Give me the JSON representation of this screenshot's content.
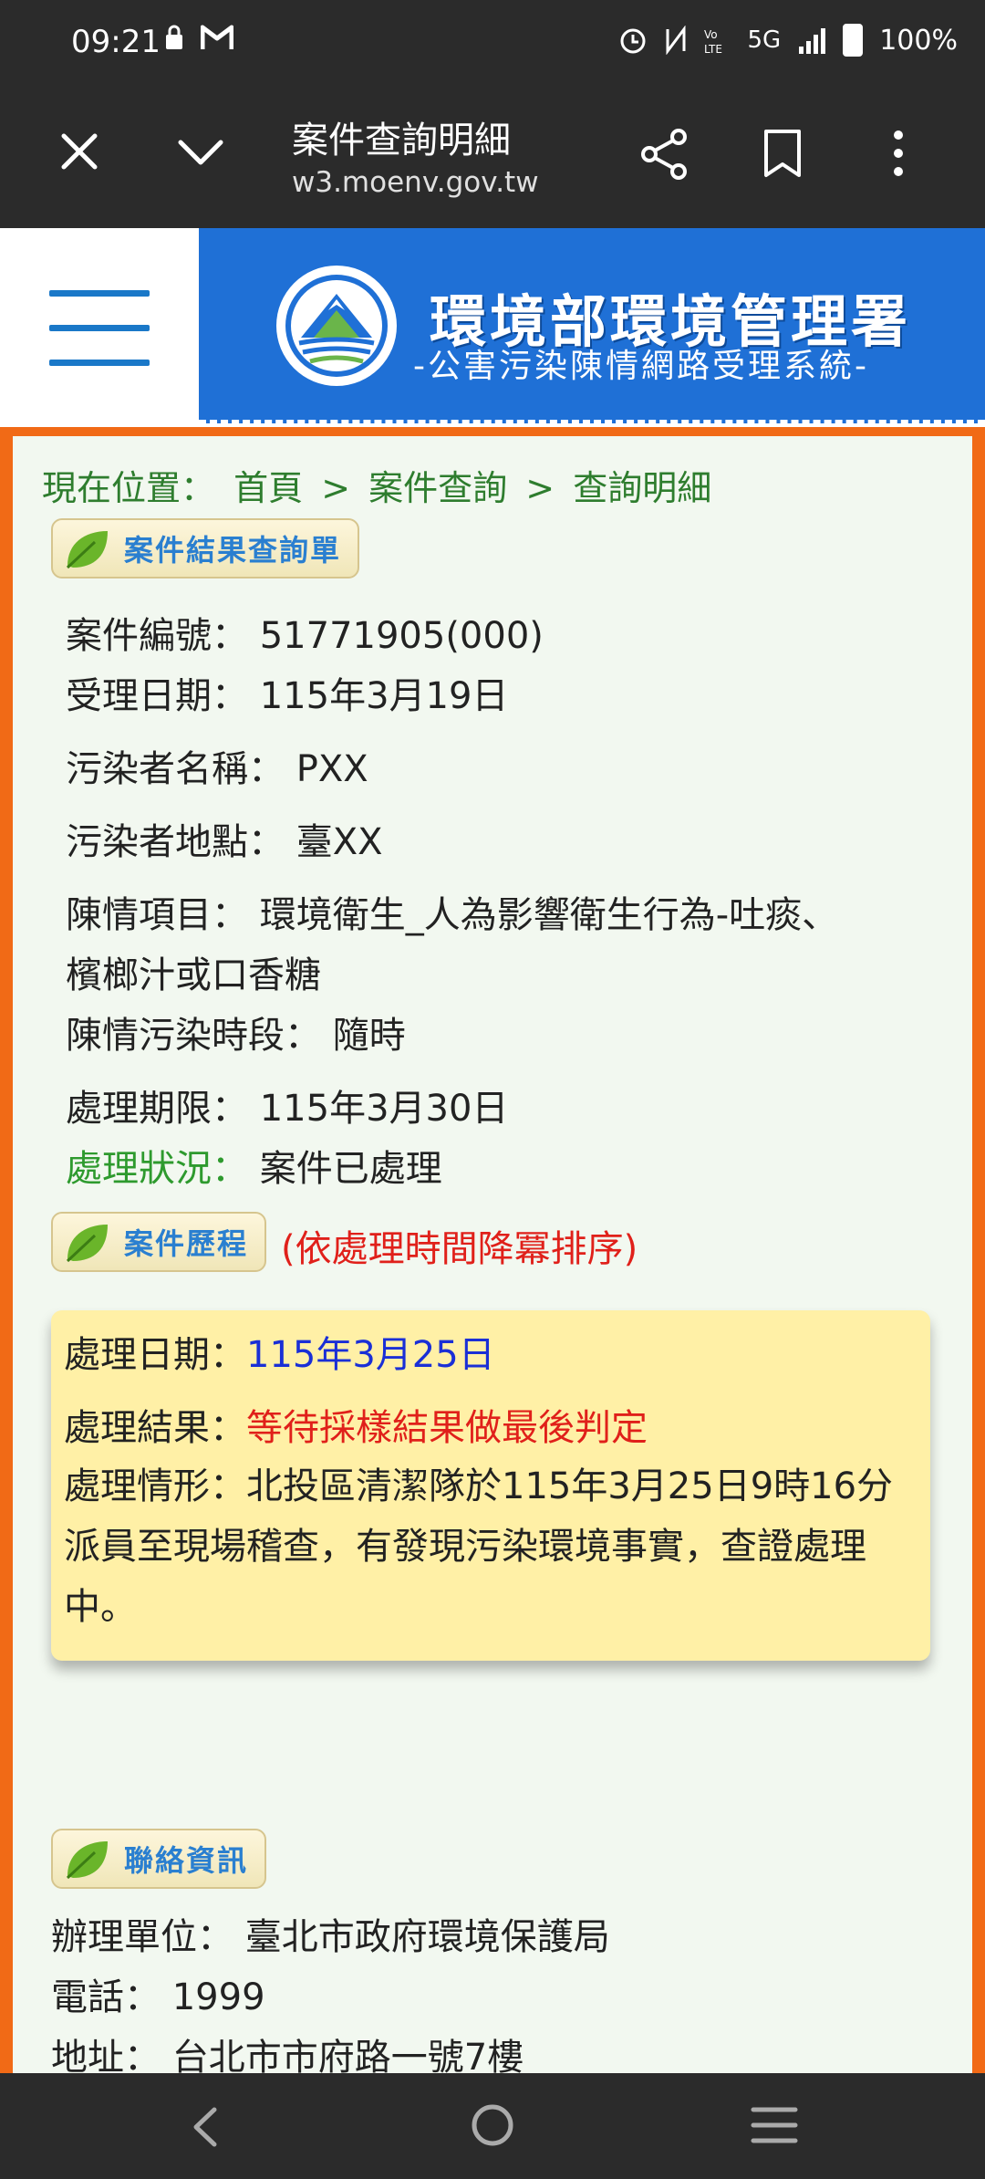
{
  "status_bar": {
    "time": "09:21",
    "battery": "100%",
    "network": "5G",
    "icons": [
      "lock-icon",
      "gmail-icon",
      "alarm-icon",
      "nfc-icon",
      "volte-icon",
      "signal-icon",
      "battery-icon"
    ]
  },
  "browser": {
    "title": "案件查詢明細",
    "url": "w3.moenv.gov.tw"
  },
  "site": {
    "title": "環境部環境管理署",
    "subtitle": "-公害污染陳情網路受理系統-"
  },
  "breadcrumb": {
    "label": "現在位置：",
    "items": [
      "首頁",
      ">",
      "案件查詢",
      ">",
      "查詢明細"
    ]
  },
  "sections": {
    "result": "案件結果查詢單",
    "history": "案件歷程",
    "history_note": "(依處理時間降冪排序)",
    "contact": "聯絡資訊"
  },
  "case": {
    "number_label": "案件編號：",
    "number": "51771905(000)",
    "date_label": "受理日期：",
    "date": "115年3月19日",
    "polluter_label": "污染者名稱：",
    "polluter": "PXX",
    "location_label": "污染者地點：",
    "location": "臺XX",
    "item_label": "陳情項目：",
    "item_line1": "環境衛生_人為影響衛生行為-吐痰、",
    "item_line2": "檳榔汁或口香糖",
    "period_label": "陳情污染時段：",
    "period": "隨時",
    "deadline_label": "處理期限：",
    "deadline": "115年3月30日",
    "status_label": "處理狀況：",
    "status": "案件已處理"
  },
  "history": {
    "date_label": "處理日期：",
    "date": "115年3月25日",
    "result_label": "處理結果：",
    "result": "等待採樣結果做最後判定",
    "detail": "處理情形：北投區清潔隊於115年3月25日9時16分派員至現場稽查，有發現污染環境事實，查證處理中。"
  },
  "contact": {
    "unit_label": "辦理單位：",
    "unit": "臺北市政府環境保護局",
    "phone_label": "電話：",
    "phone": "1999",
    "address_label": "地址：",
    "address": "台北市市府路一號7樓"
  },
  "colors": {
    "frame": "#f16a16",
    "brand": "#1f70d6",
    "green": "#2e9a2e",
    "red": "#e0201a",
    "blue": "#1a2fd6",
    "history_bg": "#fff0a6"
  }
}
